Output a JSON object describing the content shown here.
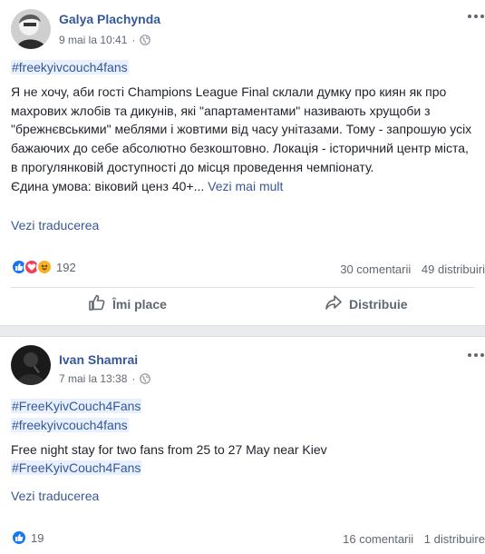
{
  "posts": [
    {
      "author": "Galya Plachynda",
      "date": "9 mai la 10:41",
      "dot": "·",
      "hashtag": "#freekyivcouch4fans",
      "text": "Я не хочу, аби гості Champions League Final склали думку про киян як про махрових жлобів та дикунів, які \"апартаментами\" називають хрущоби з \"брежнєвськими\" меблями і жовтими від часу унітазами. Тому - запрошую усіх бажаючих до себе абсолютно безкоштовно. Локація - історичний центр міста, в прогулянковій доступності до місця проведення чемпіонату.",
      "text_last": "Єдина умова: віковий ценз 40+",
      "ellipsis": "...",
      "see_more": "Vezi mai mult",
      "translate": "Vezi traducerea",
      "reaction_count": "192",
      "comments": "30 comentarii",
      "shares": "49 distribuiri",
      "like_label": "Îmi place",
      "share_label": "Distribuie"
    },
    {
      "author": "Ivan Shamrai",
      "date": "7 mai la 13:38",
      "dot": "·",
      "hashtag1": "#FreeKyivCouch4Fans",
      "hashtag2": "#freekyivcouch4fans",
      "text": "Free night stay for two fans from 25 to 27 May near Kiev",
      "hashtag3": "#FreeKyivCouch4Fans",
      "translate": "Vezi traducerea",
      "reaction_count": "19",
      "comments": "16 comentarii",
      "shares": "1 distribuire"
    }
  ],
  "colors": {
    "link": "#365899",
    "hashtag_bg": "#e8f0fd",
    "muted": "#606770",
    "like_blue": "#1877f2",
    "love_red": "#f33e58",
    "haha_yellow": "#f7b125"
  },
  "icons": [
    "globe-icon",
    "more-icon",
    "like-reaction-icon",
    "love-reaction-icon",
    "haha-reaction-icon",
    "thumbs-up-icon",
    "share-arrow-icon"
  ]
}
